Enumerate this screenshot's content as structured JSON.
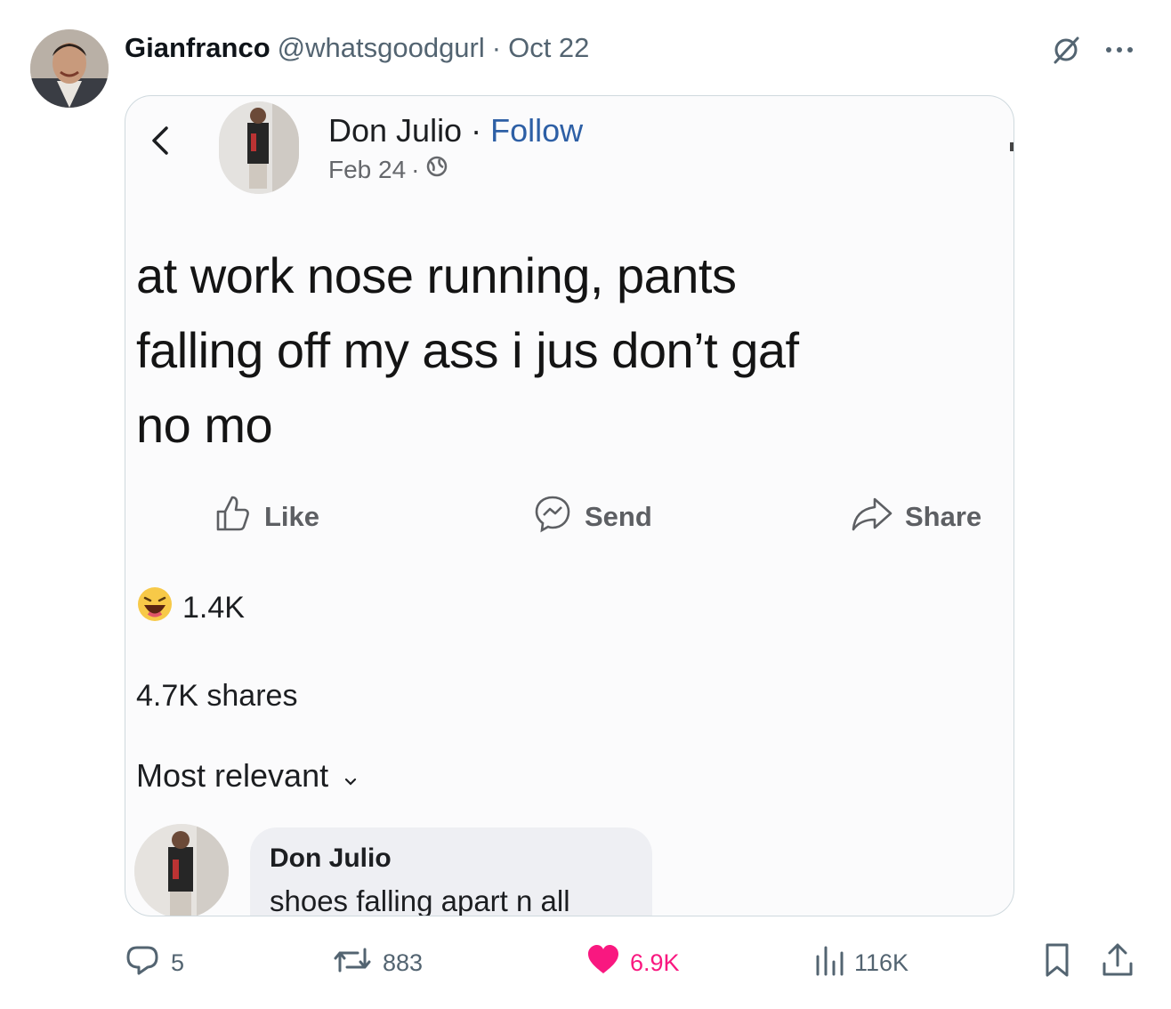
{
  "tweet": {
    "author_name": "Gianfranco",
    "author_handle": "@whatsgoodgurl",
    "separator": "·",
    "date": "Oct 22"
  },
  "embedded_post": {
    "author_name": "Don Julio",
    "follow_separator": "·",
    "follow_label": "Follow",
    "date": "Feb 24",
    "date_separator": "·",
    "lines": [
      "at work nose running, pants",
      "falling off my ass i jus don’t gaf",
      "no mo"
    ],
    "actions": {
      "like": "Like",
      "send": "Send",
      "share": "Share"
    },
    "reaction_count": "1.4K",
    "shares": "4.7K shares",
    "sort_label": "Most relevant",
    "comment": {
      "author": "Don Julio",
      "text": "shoes falling apart n all"
    }
  },
  "engagement": {
    "replies": "5",
    "retweets": "883",
    "likes": "6.9K",
    "views": "116K"
  },
  "colors": {
    "like_active": "#f91880",
    "muted": "#536471",
    "fb_link": "#2d5fa5",
    "border": "#cfd9de"
  },
  "icons": {
    "header": [
      "grok-icon",
      "more-icon"
    ],
    "actions": [
      "reply-icon",
      "retweet-icon",
      "heart-icon",
      "views-icon",
      "bookmark-icon",
      "share-icon"
    ]
  }
}
